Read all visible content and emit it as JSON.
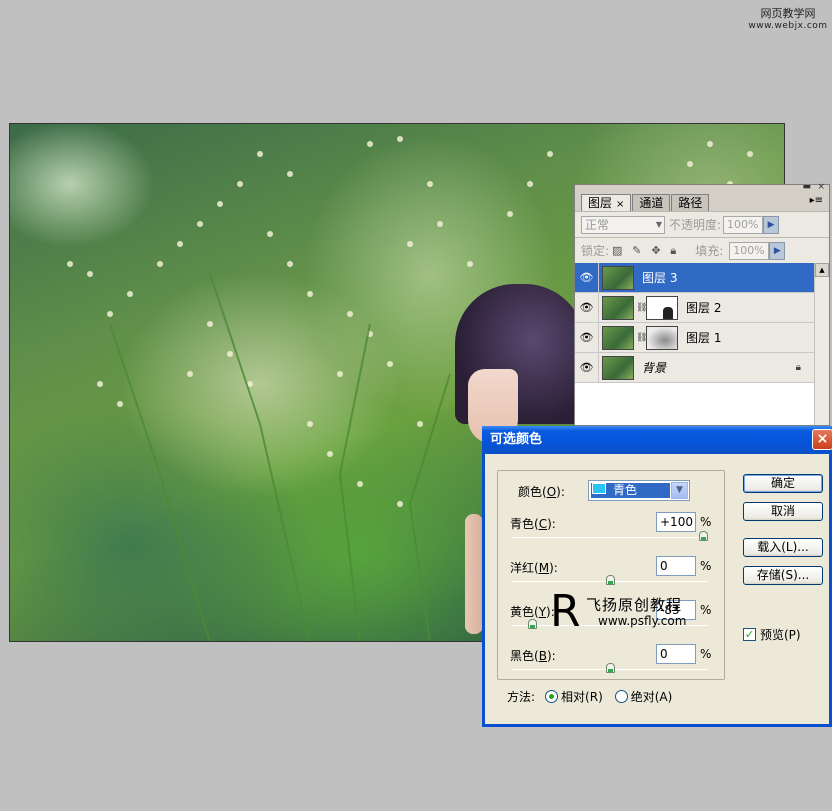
{
  "watermark_top": {
    "line1": "网页教学网",
    "line2": "www.webjx.com"
  },
  "watermark_center": {
    "letter": "R",
    "text": "飞扬原创教程",
    "url": "www.psfly.com"
  },
  "layers_panel": {
    "tabs": [
      {
        "label": "图层",
        "close": "×"
      },
      {
        "label": "通道"
      },
      {
        "label": "路径"
      }
    ],
    "menu_icon": "▸≡",
    "blend_mode": "正常",
    "opacity_label": "不透明度:",
    "opacity_value": "100%",
    "lock_label": "锁定:",
    "fill_label": "填充:",
    "fill_value": "100%",
    "layers": [
      {
        "name": "图层 3"
      },
      {
        "name": "图层 2"
      },
      {
        "name": "图层 1"
      },
      {
        "name": "背景"
      }
    ]
  },
  "dialog": {
    "title": "可选颜色",
    "close": "×",
    "colors_label": "颜色(",
    "colors_key": "O",
    "colors_label_end": "):",
    "colors_value": "青色",
    "sliders": [
      {
        "label": "青色",
        "key": "C",
        "value": "+100",
        "fraction": 1.0
      },
      {
        "label": "洋红",
        "key": "M",
        "value": "0",
        "fraction": 0.5
      },
      {
        "label": "黄色",
        "key": "Y",
        "value": "-83",
        "fraction": 0.085
      },
      {
        "label": "黑色",
        "key": "B",
        "value": "0",
        "fraction": 0.5
      }
    ],
    "percent": "%",
    "buttons": {
      "ok": "确定",
      "cancel": "取消",
      "load": "载入(L)...",
      "save": "存储(S)..."
    },
    "preview_label": "预览(P)",
    "preview_checked": true,
    "method_label": "方法:",
    "method_relative": "相对(R)",
    "method_absolute": "绝对(A)",
    "method_selected": "relative"
  },
  "colors": {
    "title_bar": "#0654d8",
    "selection": "#316ac5",
    "cyan_swatch": "#27c4f5"
  }
}
